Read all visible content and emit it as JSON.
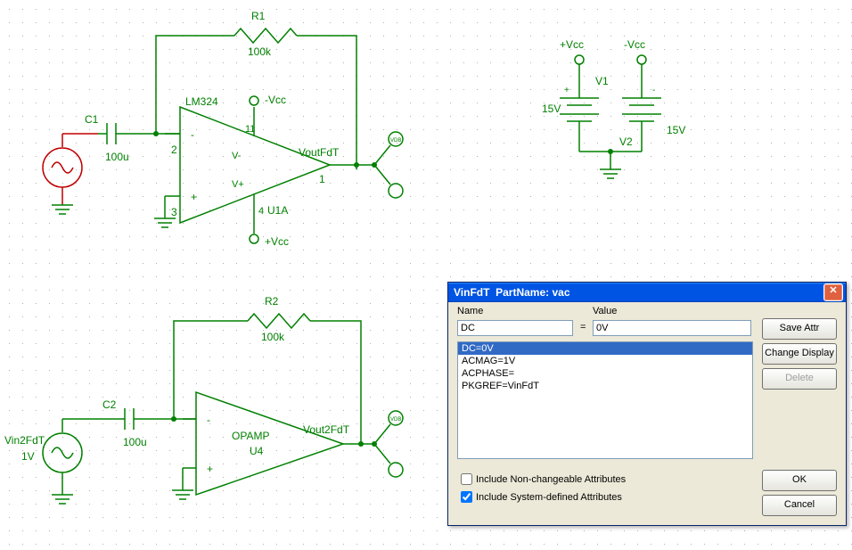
{
  "circuit1": {
    "r_label": "R1",
    "r_value": "100k",
    "c_label": "C1",
    "c_value": "100u",
    "op_label": "LM324",
    "op_ref": "U1A",
    "neg_rail": "-Vcc",
    "pos_rail": "+Vcc",
    "out_net": "VoutFdT",
    "pin_inm": "2",
    "pin_inp": "3",
    "pin_vn": "11",
    "pin_vp": "4",
    "pin_out": "1",
    "vminus": "V-",
    "vplus": "V+"
  },
  "circuit2": {
    "r_label": "R2",
    "r_value": "100k",
    "c_label": "C2",
    "c_value": "100u",
    "op_label": "OPAMP",
    "op_ref": "U4",
    "out_net": "Vout2FdT",
    "src_label": "Vin2FdT",
    "src_value": "1V"
  },
  "supply": {
    "pos_rail": "+Vcc",
    "neg_rail": "-Vcc",
    "v1_label": "V1",
    "v1_value": "15V",
    "v2_label": "V2",
    "v2_value": "15V"
  },
  "dialog": {
    "title_ref": "VinFdT",
    "title_part_label": "PartName:",
    "title_part": "vac",
    "name_label": "Name",
    "value_label": "Value",
    "name_field": "DC",
    "value_field": "0V",
    "list_items": [
      "DC=0V",
      "ACMAG=1V",
      "ACPHASE=",
      "PKGREF=VinFdT"
    ],
    "include_nonchangeable": "Include Non-changeable Attributes",
    "include_sysdefined": "Include System-defined Attributes",
    "btn_save": "Save Attr",
    "btn_change": "Change Display",
    "btn_delete": "Delete",
    "btn_ok": "OK",
    "btn_cancel": "Cancel",
    "eq": "="
  }
}
